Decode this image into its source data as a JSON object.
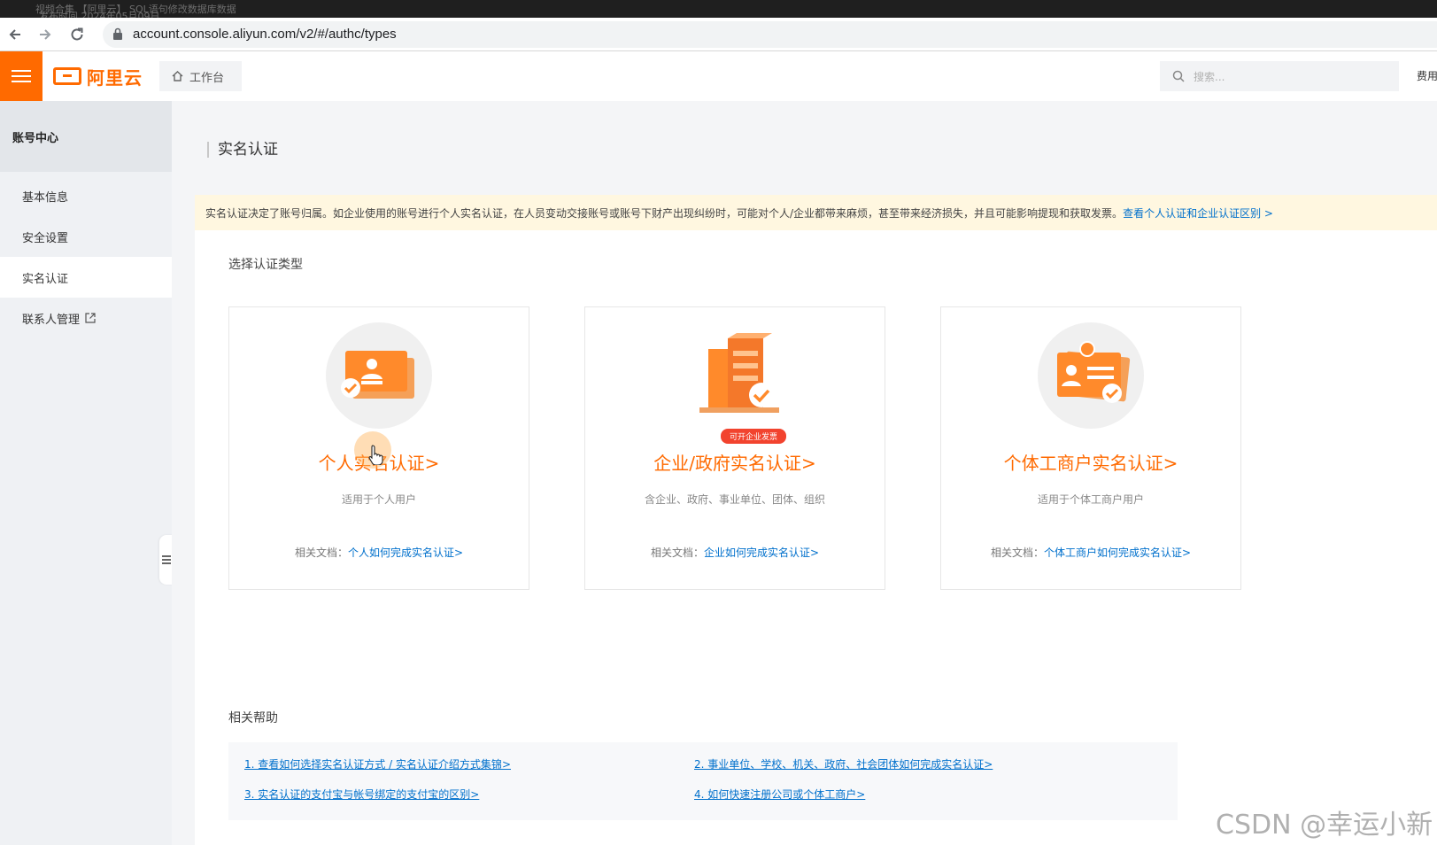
{
  "video_title": {
    "line1": "视频合集 【阿里云】 SQL语句修改数据库数据",
    "line2": "发布时间 2024年05月09日"
  },
  "browser": {
    "url": "account.console.aliyun.com/v2/#/authc/types"
  },
  "header": {
    "logo_text": "阿里云",
    "workbench_label": "工作台",
    "search_placeholder": "搜索...",
    "right_text": "费用"
  },
  "sidebar": {
    "title": "账号中心",
    "items": [
      {
        "label": "基本信息"
      },
      {
        "label": "安全设置"
      },
      {
        "label": "实名认证"
      },
      {
        "label": "联系人管理"
      }
    ]
  },
  "page": {
    "title": "实名认证",
    "notice": "实名认证决定了账号归属。如企业使用的账号进行个人实名认证，在人员变动交接账号或账号下财产出现纠纷时，可能对个人/企业都带来麻烦，甚至带来经济损失，并且可能影响提现和获取发票。",
    "notice_link": "查看个人认证和企业认证区别 >",
    "choose_label": "选择认证类型",
    "cards": [
      {
        "title": "个人实名认证>",
        "desc": "适用于个人用户",
        "doc_label": "相关文档：",
        "doc_link": "个人如何完成实名认证>"
      },
      {
        "title": "企业/政府实名认证>",
        "badge": "可开企业发票",
        "desc": "含企业、政府、事业单位、团体、组织",
        "doc_label": "相关文档：",
        "doc_link": "企业如何完成实名认证>"
      },
      {
        "title": "个体工商户实名认证>",
        "desc": "适用于个体工商户用户",
        "doc_label": "相关文档：",
        "doc_link": "个体工商户如何完成实名认证>"
      }
    ],
    "help_label": "相关帮助",
    "help_links": [
      "1. 查看如何选择实名认证方式 / 实名认证介绍方式集锦>",
      "2. 事业单位、学校、机关、政府、社会团体如何完成实名认证>",
      "3. 实名认证的支付宝与帐号绑定的支付宝的区别>",
      "4. 如何快速注册公司或个体工商户>"
    ]
  },
  "watermark": "CSDN @幸运小新",
  "colors": {
    "accent": "#ff6a00",
    "link": "#0070cc",
    "notice_bg": "#fff7e0"
  }
}
